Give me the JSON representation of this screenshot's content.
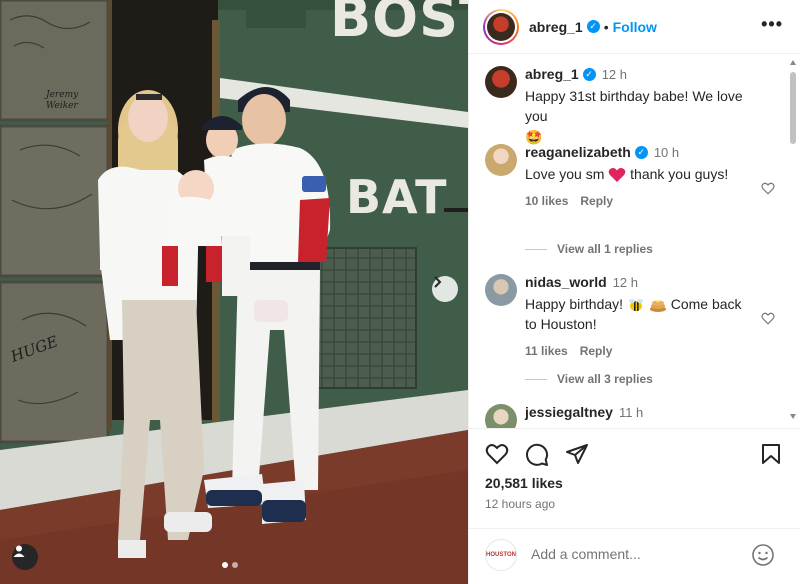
{
  "post": {
    "author": "abreg_1",
    "follow_label": "Follow",
    "more_label": "•••",
    "likes": "20,581 likes",
    "posted": "12 hours ago",
    "add_comment_placeholder": "Add a comment...",
    "commenter_avatar_text": "HOUSTON",
    "carousel_dots": 2
  },
  "photo": {
    "wall_text_top": "BOSTO",
    "wall_text_mid": "BAT",
    "graffiti": [
      "Jeremy Weiker",
      "HUGE"
    ]
  },
  "comments": [
    {
      "user": "abreg_1",
      "verified": true,
      "time": "12 h",
      "text": "Happy 31st birthday babe! We love you",
      "emoji": "🤩"
    },
    {
      "user": "reaganelizabeth",
      "verified": true,
      "time": "10 h",
      "text_before": "Love you sm",
      "text_after": "thank you guys!",
      "likes": "10 likes",
      "reply_label": "Reply",
      "view_replies": "View all 1 replies"
    },
    {
      "user": "nidas_world",
      "verified": false,
      "time": "12 h",
      "text_before": "Happy birthday!",
      "text_after": "Come back to Houston!",
      "likes": "11 likes",
      "reply_label": "Reply",
      "view_replies": "View all 3 replies"
    },
    {
      "user": "jessiegaltney",
      "verified": false,
      "time": "11 h"
    }
  ],
  "colors": {
    "accent": "#0095f6",
    "wall_green": "#3d5a45",
    "heart_red": "#e0245e"
  }
}
